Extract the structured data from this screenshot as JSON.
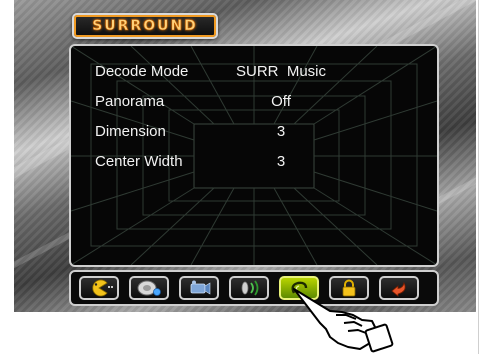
{
  "menu": {
    "title": "SURROUND",
    "settings": [
      {
        "label": "Decode Mode",
        "value": "SURR  Music"
      },
      {
        "label": "Panorama",
        "value": "Off"
      },
      {
        "label": "Dimension",
        "value": "3"
      },
      {
        "label": "Center Width",
        "value": "3"
      }
    ]
  },
  "icon_bar": {
    "items": [
      {
        "icon": "pacman-face-icon"
      },
      {
        "icon": "speaker-dish-icon"
      },
      {
        "icon": "video-camera-icon"
      },
      {
        "icon": "sound-waves-icon"
      },
      {
        "icon": "surround-swirl-icon",
        "selected": true
      },
      {
        "icon": "lock-icon"
      },
      {
        "icon": "return-arrow-icon"
      }
    ]
  },
  "colors": {
    "accent_orange": "#f09a22",
    "selected_green": "#8fb800",
    "panel_black": "#060606"
  }
}
